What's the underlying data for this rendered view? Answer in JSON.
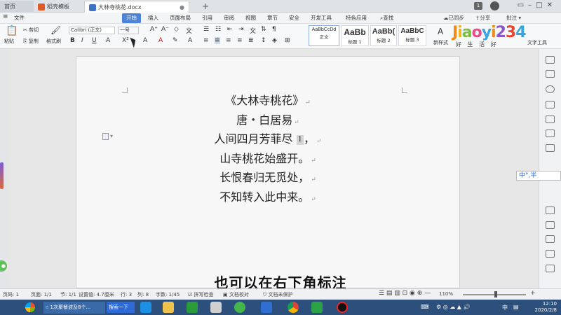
{
  "tabs": {
    "home": "首页",
    "template": "稻壳模板",
    "document": "大林寺桃花.docx",
    "add": "+",
    "badge": "1"
  },
  "menubar": {
    "file": "文件",
    "items": [
      "开始",
      "插入",
      "页面布局",
      "引用",
      "审阅",
      "视图",
      "章节",
      "安全",
      "开发工具",
      "特色应用"
    ],
    "search": "查找",
    "sync": "已同步",
    "share": "分享",
    "annotate": "批注"
  },
  "ribbon": {
    "paste": "粘贴",
    "cut": "剪切",
    "copy": "复制",
    "format_painter": "格式刷",
    "font_name": "Calibri (正文)",
    "font_size": "一号",
    "styles": [
      {
        "sample": "AaBbCcDd",
        "name": "正文"
      },
      {
        "sample": "AaBb",
        "name": "标题 1"
      },
      {
        "sample": "AaBb(",
        "name": "标题 2"
      },
      {
        "sample": "AaBbC",
        "name": "标题 3"
      }
    ],
    "new_style": "新样式",
    "text_tools": "文字工具"
  },
  "watermark": {
    "logo": "Jiaoyi234",
    "slogan": "好 生 活 好"
  },
  "poem": {
    "title": "《大林寺桃花》",
    "author": "唐・白居易",
    "line1_text": "人间四月芳菲尽",
    "footnote_ref": "1",
    "line1_end": "，",
    "line2": "山寺桃花始盛开。",
    "line3": "长恨春归无觅处，",
    "line4": "不知转入此中来。"
  },
  "ime": "中°,半",
  "subtitle": "也可以在右下角标注",
  "statusbar": {
    "page_num": "页码: 1",
    "pages": "页面: 1/1",
    "section": "节: 1/1",
    "setting": "设置值: 4.7厘米",
    "row": "行: 3",
    "col": "列: 8",
    "words": "字数: 1/45",
    "spell": "拼写检查",
    "proof": "文档校对",
    "protect": "文档未保护",
    "zoom": "110%"
  },
  "taskbar": {
    "app1": "1次聚餐波及8个...",
    "search": "搜索一下",
    "lang": "中",
    "time": "12:10",
    "date": "2020/2/8"
  },
  "colors": {
    "accent": "#4b83d8",
    "taskbar": "#2c4f7c",
    "highlight": "#ffeb14"
  }
}
